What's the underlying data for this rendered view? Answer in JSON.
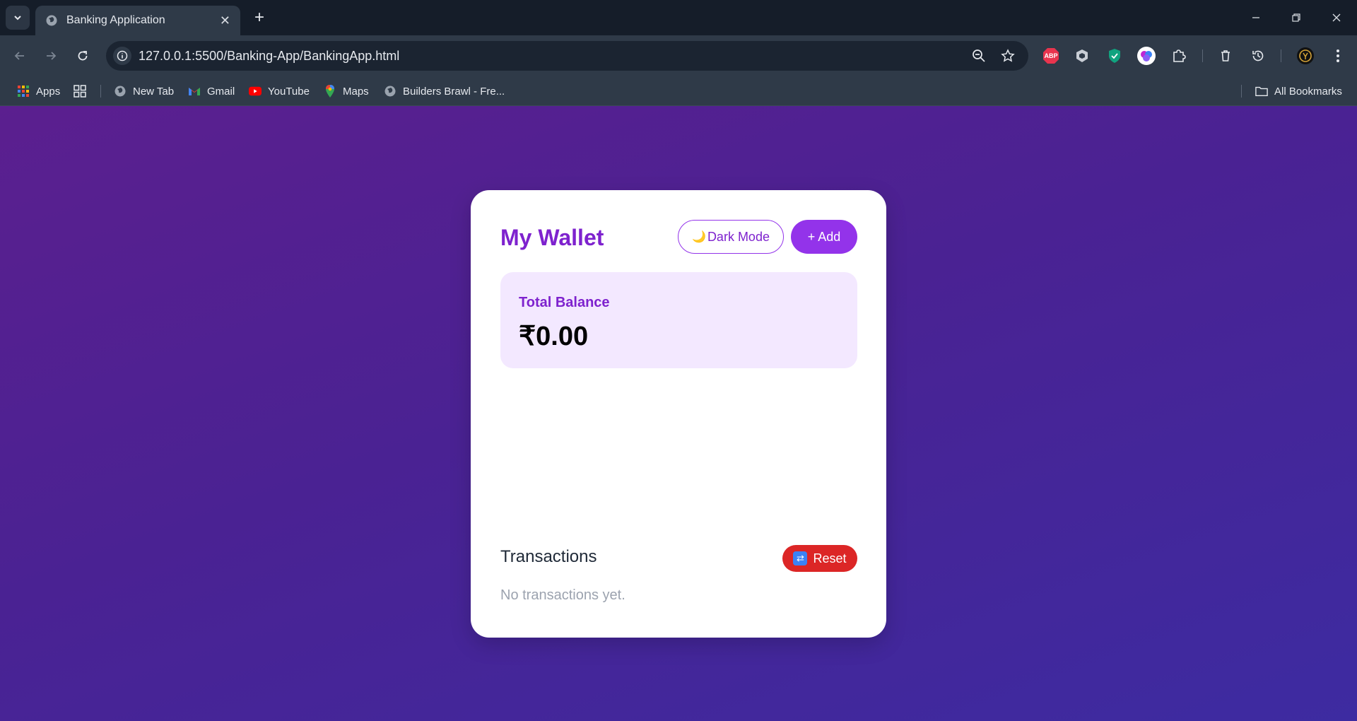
{
  "browser": {
    "tab_title": "Banking Application",
    "url": "127.0.0.1:5500/Banking-App/BankingApp.html",
    "bookmarks": {
      "apps": "Apps",
      "new_tab": "New Tab",
      "gmail": "Gmail",
      "youtube": "YouTube",
      "maps": "Maps",
      "builders": "Builders Brawl - Fre...",
      "all_bookmarks": "All Bookmarks"
    },
    "extensions": {
      "abp": "ABP"
    }
  },
  "wallet": {
    "title": "My Wallet",
    "dark_mode_label": "Dark Mode",
    "dark_mode_emoji": "🌙",
    "add_label": "+ Add",
    "balance_label": "Total Balance",
    "balance_value": "₹0.00"
  },
  "transactions": {
    "title": "Transactions",
    "reset_label": "Reset",
    "empty_text": "No transactions yet."
  },
  "colors": {
    "accent": "#9333ea",
    "accent_dark": "#7e22ce",
    "balance_bg": "#f3e8ff",
    "reset": "#dc2626"
  }
}
